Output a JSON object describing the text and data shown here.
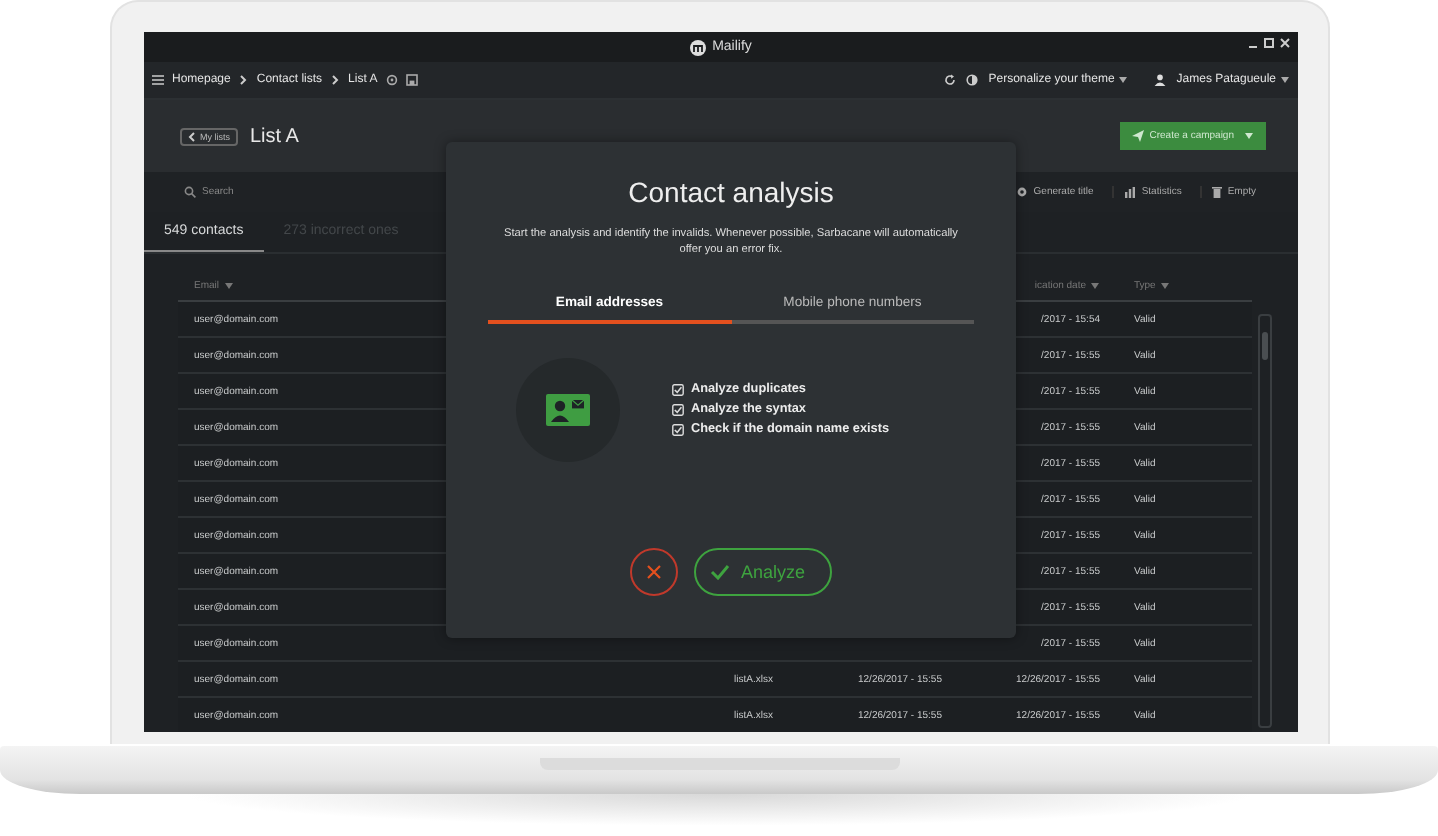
{
  "window": {
    "app_name": "Mailify"
  },
  "breadcrumb": [
    "Homepage",
    "Contact lists",
    "List A"
  ],
  "theme_menu": "Personalize your theme",
  "user_menu": "James Patagueule",
  "back_button": "My lists",
  "page_title": "List A",
  "create_button": "Create a campaign",
  "search": {
    "placeholder": "Search"
  },
  "toolbar_actions": [
    {
      "kind": "generate",
      "label": "Generate title"
    },
    {
      "kind": "statistics",
      "label": "Statistics"
    },
    {
      "kind": "empty",
      "label": "Empty"
    }
  ],
  "tabs": [
    {
      "label": "549 contacts",
      "selected": true
    },
    {
      "label": "273 incorrect ones",
      "selected": false
    }
  ],
  "table": {
    "columns": [
      "Email",
      "ication date",
      "Type"
    ],
    "rows": [
      {
        "email": "user@domain.com",
        "date": "/2017 - 15:54",
        "type": "Valid"
      },
      {
        "email": "user@domain.com",
        "date": "/2017 - 15:55",
        "type": "Valid"
      },
      {
        "email": "user@domain.com",
        "date": "/2017 - 15:55",
        "type": "Valid"
      },
      {
        "email": "user@domain.com",
        "date": "/2017 - 15:55",
        "type": "Valid"
      },
      {
        "email": "user@domain.com",
        "date": "/2017 - 15:55",
        "type": "Valid"
      },
      {
        "email": "user@domain.com",
        "date": "/2017 - 15:55",
        "type": "Valid"
      },
      {
        "email": "user@domain.com",
        "date": "/2017 - 15:55",
        "type": "Valid"
      },
      {
        "email": "user@domain.com",
        "date": "/2017 - 15:55",
        "type": "Valid"
      },
      {
        "email": "user@domain.com",
        "date": "/2017 - 15:55",
        "type": "Valid"
      },
      {
        "email": "user@domain.com",
        "date": "/2017 - 15:55",
        "type": "Valid"
      },
      {
        "email": "user@domain.com",
        "column_2": "listA.xlsx",
        "column_3": "12/26/2017 - 15:55",
        "date": "12/26/2017 - 15:55",
        "type": "Valid"
      },
      {
        "email": "user@domain.com",
        "column_2": "listA.xlsx",
        "column_3": "12/26/2017 - 15:55",
        "date": "12/26/2017 - 15:55",
        "type": "Valid"
      }
    ]
  },
  "modal": {
    "title": "Contact analysis",
    "description": "Start the analysis and identify the invalids. Whenever possible, Sarbacane will automatically offer you an error fix.",
    "tabs": [
      {
        "label": "Email addresses",
        "selected": true
      },
      {
        "label": "Mobile phone numbers",
        "selected": false
      }
    ],
    "options": [
      {
        "label": "Analyze duplicates",
        "checked": true
      },
      {
        "label": "Analyze the syntax",
        "checked": true
      },
      {
        "label": "Check if the domain name exists",
        "checked": true
      }
    ],
    "analyze_button": "Analyze"
  }
}
